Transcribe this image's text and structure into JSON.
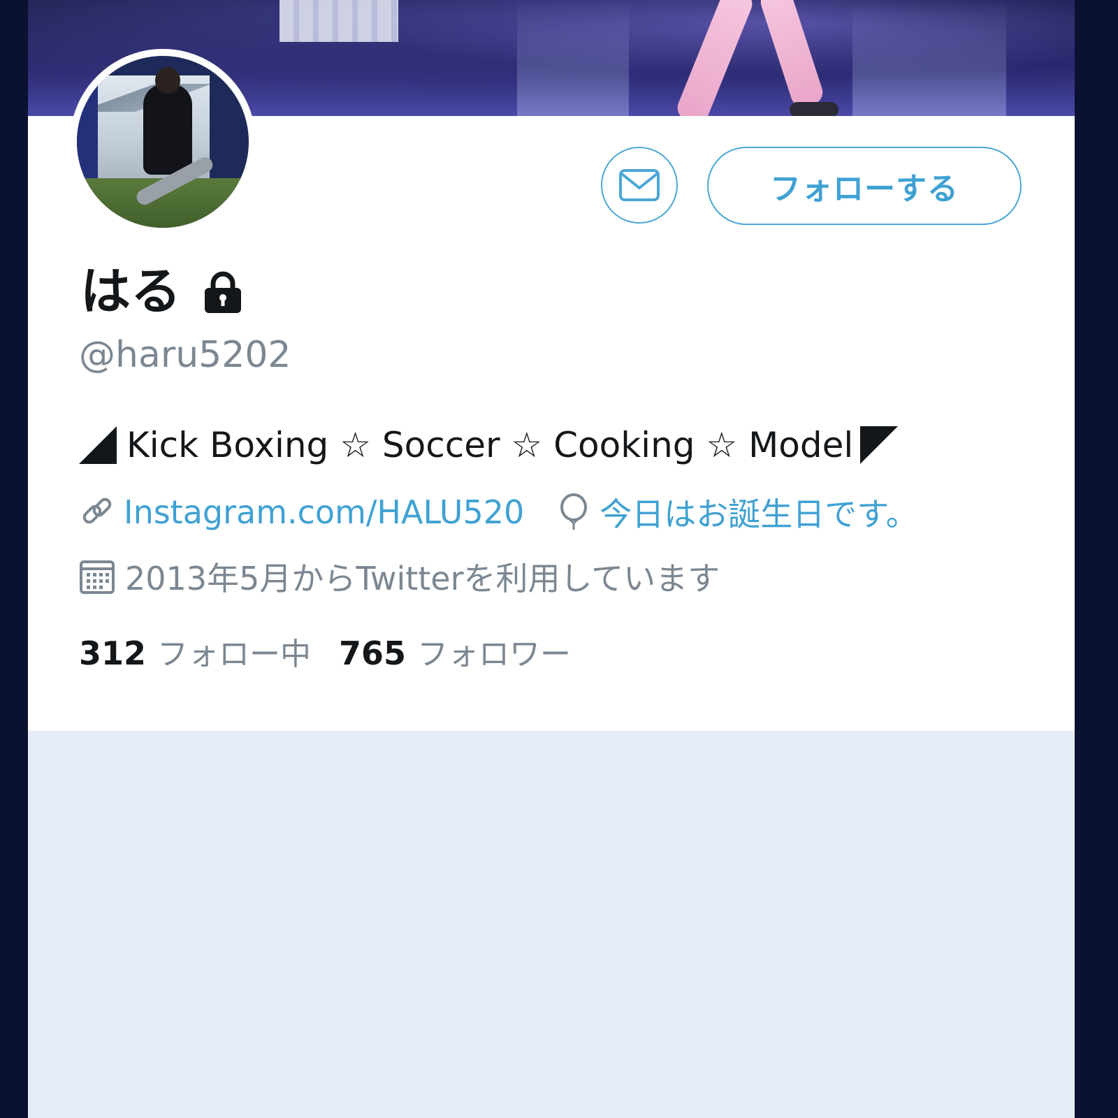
{
  "profile": {
    "display_name": "はる",
    "handle": "@haru5202",
    "bio": {
      "left_marker": "◢",
      "text": "Kick Boxing ☆ Soccer ☆ Cooking ☆ Model",
      "right_marker": "◤"
    },
    "link": "Instagram.com/HALU520",
    "birthday": "今日はお誕生日です。",
    "joined": "2013年5月からTwitterを利用しています",
    "following_count": "312",
    "following_label": "フォロー中",
    "followers_count": "765",
    "followers_label": "フォロワー"
  },
  "actions": {
    "follow_label": "フォローする"
  },
  "icons": {
    "message": "mail-icon",
    "protected": "lock-icon",
    "link": "link-icon",
    "birthday": "balloon-icon",
    "joined": "calendar-icon"
  },
  "colors": {
    "accent": "#3fa1d3",
    "text_primary": "#14171a",
    "text_secondary": "#7b8792",
    "background_lower": "#e6ecf5",
    "frame": "#0c1330"
  }
}
